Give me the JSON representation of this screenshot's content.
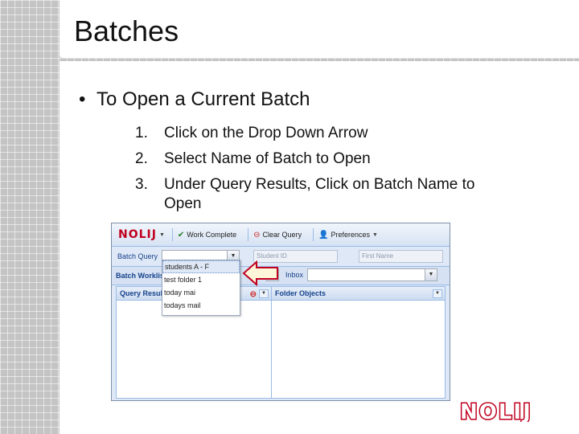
{
  "slide": {
    "title": "Batches",
    "bullet": "To Open a Current Batch",
    "steps": [
      {
        "num": "1.",
        "text": "Click on the Drop Down Arrow"
      },
      {
        "num": "2.",
        "text": "Select Name of Batch to Open"
      },
      {
        "num": "3.",
        "text": "Under Query Results, Click on Batch Name to"
      }
    ],
    "step3_continuation": "Open"
  },
  "app": {
    "brand": "NOLIJ",
    "toolbar": {
      "work_complete": "Work Complete",
      "clear_query": "Clear Query",
      "preferences": "Preferences"
    },
    "query_row": {
      "batch_query_label": "Batch Query",
      "student_id_placeholder": "Student ID",
      "first_name_placeholder": "First Name"
    },
    "worklist_row": {
      "batch_worklist_label": "Batch Worklist",
      "inbox_label": "Inbox"
    },
    "panels": {
      "query_results": "Query Results",
      "folder_objects": "Folder Objects"
    },
    "dropdown_options": [
      "students A - F",
      "test folder 1",
      "today mai",
      "todays mail"
    ],
    "selected_option_index": 0
  },
  "footer": {
    "logo_text": "NOLIJ"
  },
  "colors": {
    "brand_red": "#c0001f",
    "panel_blue": "#dfe8f6",
    "header_blue": "#15428b"
  }
}
